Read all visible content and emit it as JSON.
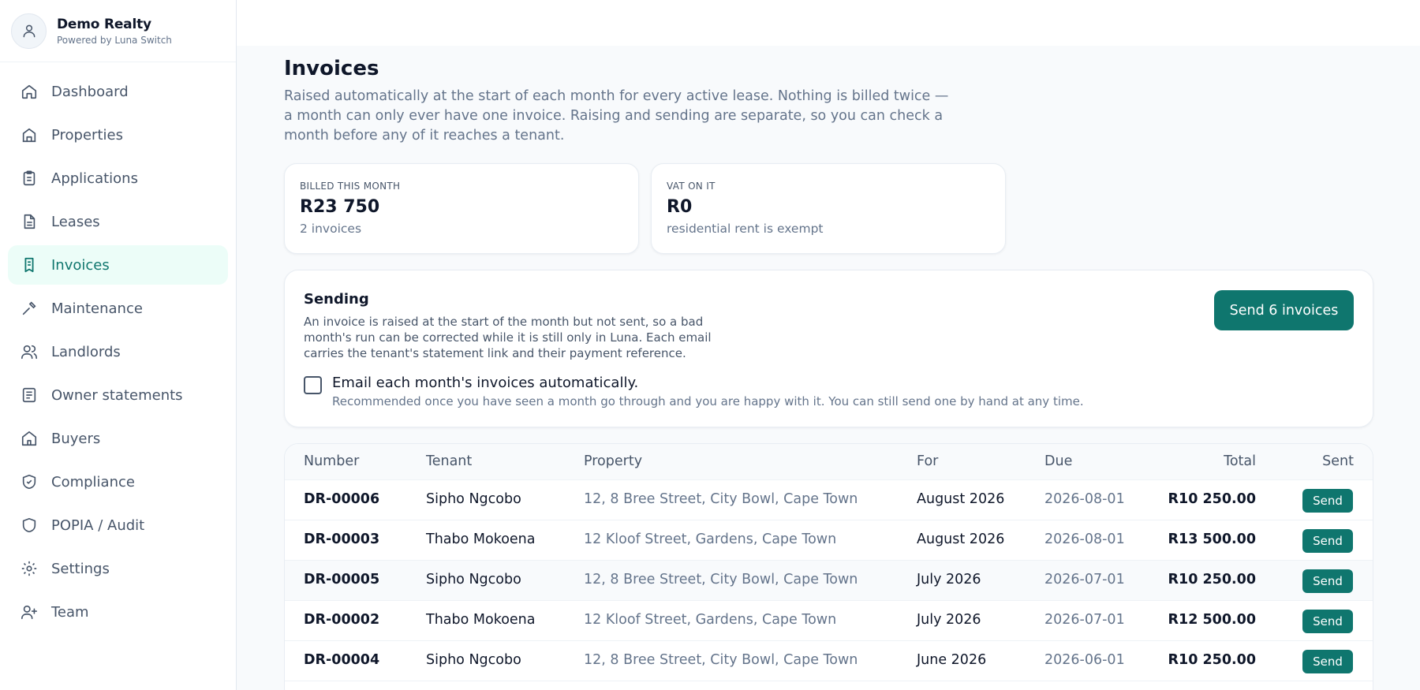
{
  "brand": {
    "name": "Demo Realty",
    "subtitle": "Powered by Luna Switch"
  },
  "sidebar": {
    "active": "Invoices",
    "items": [
      {
        "label": "Dashboard",
        "icon": "home-icon"
      },
      {
        "label": "Properties",
        "icon": "building-icon"
      },
      {
        "label": "Applications",
        "icon": "clipboard-icon"
      },
      {
        "label": "Leases",
        "icon": "document-icon"
      },
      {
        "label": "Invoices",
        "icon": "receipt-icon"
      },
      {
        "label": "Maintenance",
        "icon": "wrench-icon"
      },
      {
        "label": "Landlords",
        "icon": "users-icon"
      },
      {
        "label": "Owner statements",
        "icon": "statement-icon"
      },
      {
        "label": "Buyers",
        "icon": "house-icon"
      },
      {
        "label": "Compliance",
        "icon": "shield-check-icon"
      },
      {
        "label": "POPIA / Audit",
        "icon": "shield-icon"
      },
      {
        "label": "Settings",
        "icon": "gear-icon"
      },
      {
        "label": "Team",
        "icon": "user-plus-icon"
      }
    ]
  },
  "page": {
    "title": "Invoices",
    "description": "Raised automatically at the start of each month for every active lease. Nothing is billed twice — a month can only ever have one invoice. Raising and sending are separate, so you can check a month before any of it reaches a tenant."
  },
  "stats": {
    "billed": {
      "label": "BILLED THIS MONTH",
      "value": "R23 750",
      "sub": "2 invoices"
    },
    "vat": {
      "label": "VAT ON IT",
      "value": "R0",
      "sub": "residential rent is exempt"
    }
  },
  "sending": {
    "title": "Sending",
    "description": "An invoice is raised at the start of the month but not sent, so a bad month's run can be corrected while it is still only in Luna. Each email carries the tenant's statement link and their payment reference.",
    "button_label": "Send 6 invoices",
    "auto_label": "Email each month's invoices automatically.",
    "auto_help": "Recommended once you have seen a month go through and you are happy with it. You can still send one by hand at any time.",
    "auto_checked": false
  },
  "table": {
    "headers": {
      "number": "Number",
      "tenant": "Tenant",
      "property": "Property",
      "for": "For",
      "due": "Due",
      "total": "Total",
      "sent": "Sent"
    },
    "rows": [
      {
        "number": "DR-00006",
        "tenant": "Sipho Ngcobo",
        "property": "12, 8 Bree Street, City Bowl, Cape Town",
        "for": "August 2026",
        "due": "2026-08-01",
        "total": "R10 250.00",
        "action": "Send"
      },
      {
        "number": "DR-00003",
        "tenant": "Thabo Mokoena",
        "property": "12 Kloof Street, Gardens, Cape Town",
        "for": "August 2026",
        "due": "2026-08-01",
        "total": "R13 500.00",
        "action": "Send"
      },
      {
        "number": "DR-00005",
        "tenant": "Sipho Ngcobo",
        "property": "12, 8 Bree Street, City Bowl, Cape Town",
        "for": "July 2026",
        "due": "2026-07-01",
        "total": "R10 250.00",
        "action": "Send"
      },
      {
        "number": "DR-00002",
        "tenant": "Thabo Mokoena",
        "property": "12 Kloof Street, Gardens, Cape Town",
        "for": "July 2026",
        "due": "2026-07-01",
        "total": "R12 500.00",
        "action": "Send"
      },
      {
        "number": "DR-00004",
        "tenant": "Sipho Ngcobo",
        "property": "12, 8 Bree Street, City Bowl, Cape Town",
        "for": "June 2026",
        "due": "2026-06-01",
        "total": "R10 250.00",
        "action": "Send"
      }
    ]
  },
  "colors": {
    "accent": "#0f766e",
    "active_bg": "#ecfdf8",
    "muted_text": "#64748b"
  }
}
